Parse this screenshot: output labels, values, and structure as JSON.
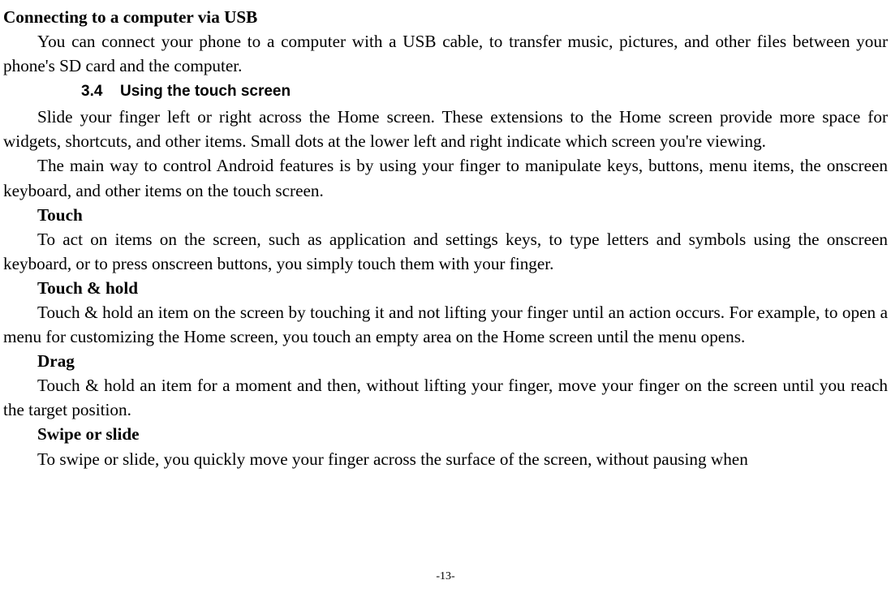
{
  "heading1": "Connecting to a computer via USB",
  "p1": "You can connect your phone to a computer with a USB cable, to transfer music, pictures, and other files between your phone's SD card and the computer.",
  "section": {
    "num": "3.4",
    "title": "Using the touch screen"
  },
  "p2": "Slide your finger left or right across the Home screen. These extensions to the Home screen provide more space for widgets, shortcuts, and other items. Small dots at the lower left and right indicate which screen you're viewing.",
  "p3": "The main way to control Android features is by using your finger to manipulate keys, buttons, menu items, the onscreen keyboard, and other items on the touch screen.",
  "touch_label": "Touch",
  "p4": "To act on items on the screen, such as application and settings keys, to type letters and symbols using the onscreen keyboard, or to press onscreen buttons, you simply touch them with your finger.",
  "touchhold_label": "Touch & hold",
  "p5": "Touch & hold an item on the screen by touching it and not lifting your finger until an action occurs. For example, to open a menu for customizing the Home screen, you touch an empty area on the Home screen until the menu opens.",
  "drag_label": "Drag",
  "p6": "Touch & hold an item for a moment and then, without lifting your finger, move your finger on the screen until you reach the target position.",
  "swipe_label": "Swipe or slide",
  "p7": "To swipe or slide, you quickly move your finger across the surface of the screen, without pausing when",
  "page_number": "-13-"
}
